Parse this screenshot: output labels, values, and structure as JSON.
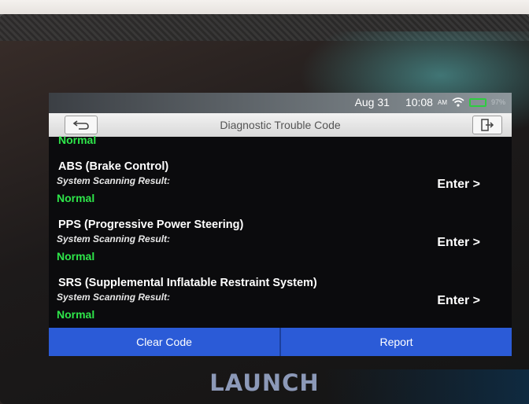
{
  "status": {
    "date": "Aug 31",
    "time": "10:08",
    "ampm": "AM",
    "battery": "97%"
  },
  "header": {
    "title": "Diagnostic Trouble Code"
  },
  "list": {
    "top_result": "Normal",
    "items": [
      {
        "title": "ABS (Brake Control)",
        "label": "System Scanning Result:",
        "result": "Normal",
        "action": "Enter >"
      },
      {
        "title": "PPS (Progressive Power Steering)",
        "label": "System Scanning Result:",
        "result": "Normal",
        "action": "Enter >"
      },
      {
        "title": "SRS (Supplemental Inflatable Restraint System)",
        "label": "System Scanning Result:",
        "result": "Normal",
        "action": "Enter >"
      }
    ]
  },
  "footer": {
    "clear_label": "Clear Code",
    "report_label": "Report"
  },
  "device": {
    "brand": "LAUNCH"
  },
  "colors": {
    "accent": "#2b5bd7",
    "normal_status": "#2ee64a"
  }
}
